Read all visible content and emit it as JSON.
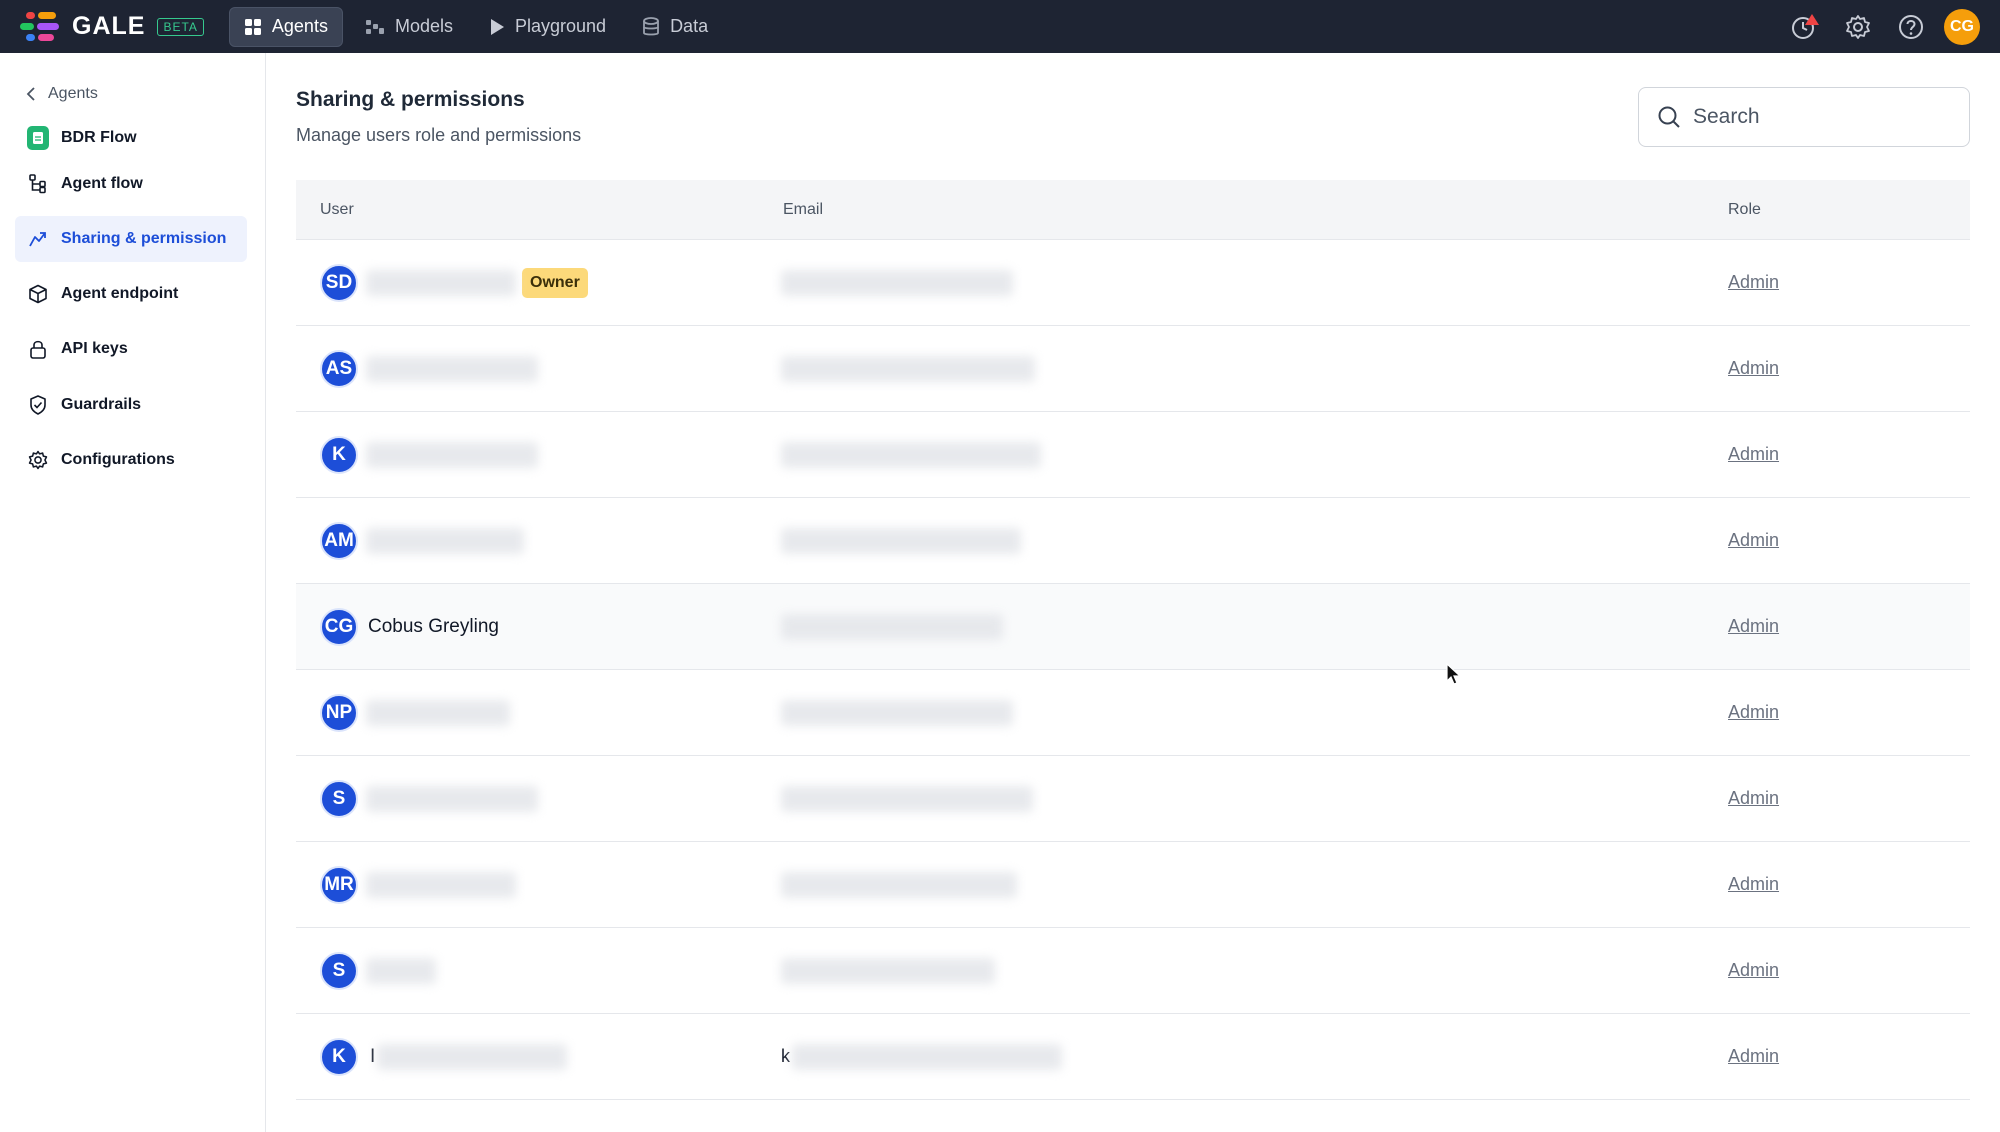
{
  "app": {
    "name": "GALE",
    "badge": "BETA",
    "brand_colors": [
      "#ef4444",
      "#f59e0b",
      "#22c55e",
      "#3b82f6",
      "#a855f7",
      "#ec4899"
    ]
  },
  "nav": {
    "items": [
      {
        "label": "Agents",
        "icon": "grid-icon",
        "active": true
      },
      {
        "label": "Models",
        "icon": "models-icon",
        "active": false
      },
      {
        "label": "Playground",
        "icon": "play-icon",
        "active": false
      },
      {
        "label": "Data",
        "icon": "database-icon",
        "active": false
      }
    ]
  },
  "topbar": {
    "user_initials": "CG",
    "icons": [
      "alert-clock-icon",
      "gear-icon",
      "help-icon"
    ]
  },
  "sidebar": {
    "back_label": "Agents",
    "items": [
      {
        "label": "BDR Flow",
        "icon": "document-icon",
        "active": false
      },
      {
        "label": "Agent flow",
        "icon": "flow-icon",
        "active": false
      },
      {
        "label": "Sharing & permission",
        "icon": "share-icon",
        "active": true
      },
      {
        "label": "Agent endpoint",
        "icon": "cube-icon",
        "active": false
      },
      {
        "label": "API keys",
        "icon": "lock-icon",
        "active": false
      },
      {
        "label": "Guardrails",
        "icon": "shield-icon",
        "active": false
      },
      {
        "label": "Configurations",
        "icon": "gear-icon",
        "active": false
      }
    ]
  },
  "page": {
    "title": "Sharing & permissions",
    "subtitle": "Manage users role and permissions",
    "search_placeholder": "Search"
  },
  "table": {
    "headers": {
      "user": "User",
      "email": "Email",
      "role": "Role"
    },
    "owner_label": "Owner",
    "rows": [
      {
        "initials": "SD",
        "name": "",
        "email": "",
        "role": "Admin",
        "owner": true
      },
      {
        "initials": "AS",
        "name": "",
        "email": "",
        "role": "Admin",
        "owner": false
      },
      {
        "initials": "K",
        "name": "",
        "email": "",
        "role": "Admin",
        "owner": false
      },
      {
        "initials": "AM",
        "name": "",
        "email": "",
        "role": "Admin",
        "owner": false
      },
      {
        "initials": "CG",
        "name": "Cobus Greyling",
        "email": "",
        "role": "Admin",
        "owner": false
      },
      {
        "initials": "NP",
        "name": "",
        "email": "",
        "role": "Admin",
        "owner": false
      },
      {
        "initials": "S",
        "name": "",
        "email": "",
        "role": "Admin",
        "owner": false
      },
      {
        "initials": "MR",
        "name": "",
        "email": "",
        "role": "Admin",
        "owner": false
      },
      {
        "initials": "S",
        "name": "",
        "email": "",
        "role": "Admin",
        "owner": false
      },
      {
        "initials": "K",
        "name": "I",
        "email": "k",
        "role": "Admin",
        "owner": false
      }
    ]
  }
}
